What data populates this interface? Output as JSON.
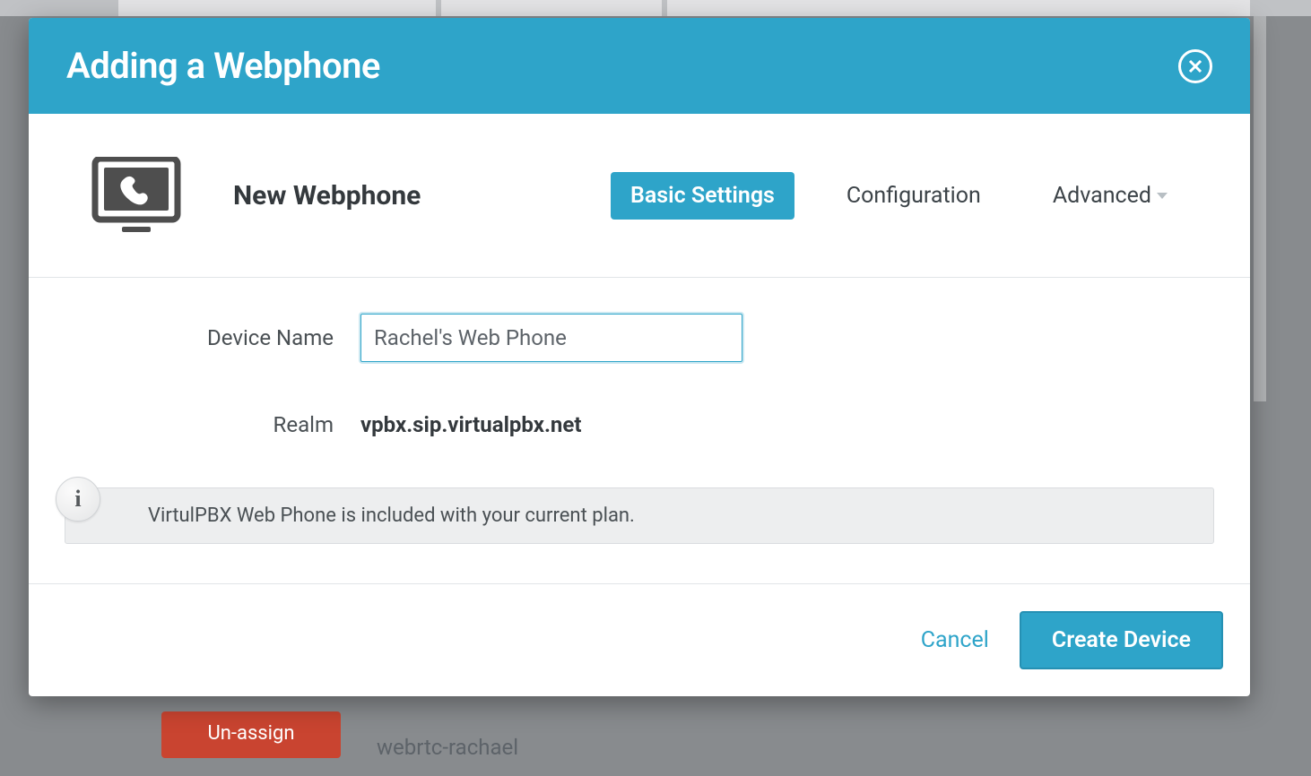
{
  "modal": {
    "title": "Adding a Webphone",
    "subhead_title": "New Webphone",
    "tabs": {
      "basic": "Basic Settings",
      "config": "Configuration",
      "advanced": "Advanced"
    }
  },
  "form": {
    "device_name_label": "Device Name",
    "device_name_value": "Rachel's Web Phone",
    "realm_label": "Realm",
    "realm_value": "vpbx.sip.virtualpbx.net"
  },
  "info": {
    "message": "VirtulPBX Web Phone is included with your current plan."
  },
  "footer": {
    "cancel": "Cancel",
    "create": "Create Device"
  },
  "background": {
    "unassign_button": "Un-assign",
    "row_text": "webrtc-rachael"
  }
}
